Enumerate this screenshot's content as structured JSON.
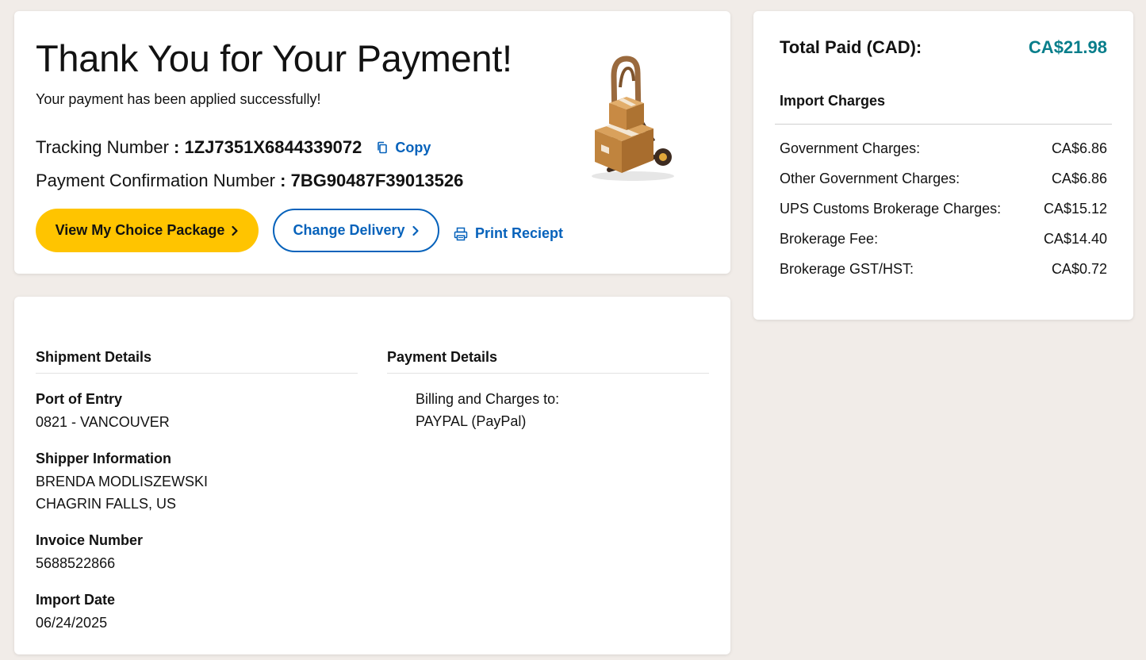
{
  "confirmation": {
    "title": "Thank You for Your Payment!",
    "subtitle": "Your payment has been applied successfully!",
    "tracking_label": "Tracking Number",
    "tracking_number": "1ZJ7351X6844339072",
    "copy_label": "Copy",
    "confirmation_label": "Payment Confirmation Number",
    "confirmation_number": "7BG90487F39013526",
    "separator": " : ",
    "buttons": {
      "view_package": "View My Choice Package",
      "change_delivery": "Change Delivery",
      "print_receipt": "Print Reciept"
    }
  },
  "shipment": {
    "heading": "Shipment Details",
    "port_label": "Port of Entry",
    "port_value": "0821 - VANCOUVER",
    "shipper_label": "Shipper Information",
    "shipper_name": "BRENDA MODLISZEWSKI",
    "shipper_location": "CHAGRIN FALLS, US",
    "invoice_label": "Invoice Number",
    "invoice_value": "5688522866",
    "import_date_label": "Import Date",
    "import_date_value": "06/24/2025"
  },
  "payment": {
    "heading": "Payment Details",
    "billing_label": "Billing and Charges to:",
    "billing_value": "PAYPAL (PayPal)"
  },
  "summary": {
    "total_label": "Total Paid (CAD):",
    "total_value": "CA$21.98",
    "import_heading": "Import Charges",
    "charges": [
      {
        "label": "Government Charges:",
        "value": "CA$6.86"
      },
      {
        "label": "Other Government Charges:",
        "value": "CA$6.86"
      },
      {
        "label": "UPS Customs Brokerage Charges:",
        "value": "CA$15.12"
      },
      {
        "label": "Brokerage Fee:",
        "value": "CA$14.40"
      },
      {
        "label": "Brokerage GST/HST:",
        "value": "CA$0.72"
      }
    ]
  },
  "colors": {
    "accent_yellow": "#ffc400",
    "link_blue": "#0662bb",
    "total_teal": "#087e8b",
    "page_bg": "#f1ece8"
  },
  "icons": [
    "copy-icon",
    "chevron-right-icon",
    "printer-icon",
    "hand-truck-boxes-illustration"
  ]
}
